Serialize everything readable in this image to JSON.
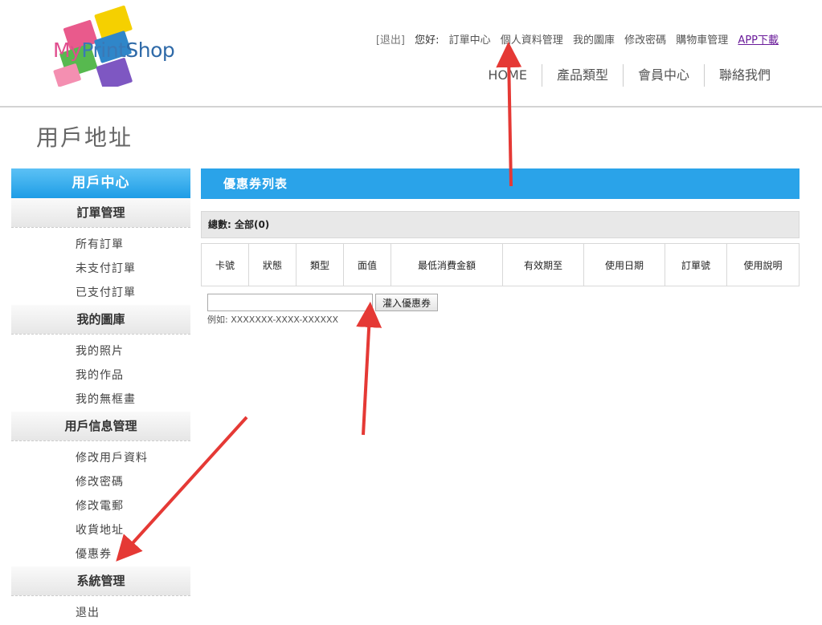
{
  "logo": {
    "part1": "My",
    "part2": "Print",
    "part3": "Shop"
  },
  "top_links": [
    "[退出]",
    "您好:",
    "訂單中心",
    "個人資料管理",
    "我的圖庫",
    "修改密碼",
    "購物車管理",
    "APP下載"
  ],
  "main_nav": [
    "HOME",
    "產品類型",
    "會員中心",
    "聯絡我們"
  ],
  "page_title": "用戶地址",
  "sidebar": {
    "title": "用戶中心",
    "groups": [
      {
        "label": "訂單管理",
        "items": [
          "所有訂單",
          "未支付訂單",
          "已支付訂單"
        ]
      },
      {
        "label": "我的圖庫",
        "items": [
          "我的照片",
          "我的作品",
          "我的無框畫"
        ]
      },
      {
        "label": "用戶信息管理",
        "items": [
          "修改用戶資料",
          "修改密碼",
          "修改電郵",
          "收貨地址",
          "優惠券"
        ]
      },
      {
        "label": "系統管理",
        "items": [
          "退出"
        ]
      }
    ]
  },
  "content": {
    "panel_title": "優惠券列表",
    "summary": "總數: 全部(0)",
    "columns": [
      "卡號",
      "狀態",
      "類型",
      "面值",
      "最低消費金額",
      "有效期至",
      "使用日期",
      "訂單號",
      "使用說明"
    ],
    "coupon_input": {
      "value": "",
      "placeholder": ""
    },
    "coupon_button": "灌入優惠券",
    "example": "例如: XXXXXXX-XXXX-XXXXXX"
  },
  "colors": {
    "accent": "#2aa3e9",
    "arrow": "#e53935"
  }
}
